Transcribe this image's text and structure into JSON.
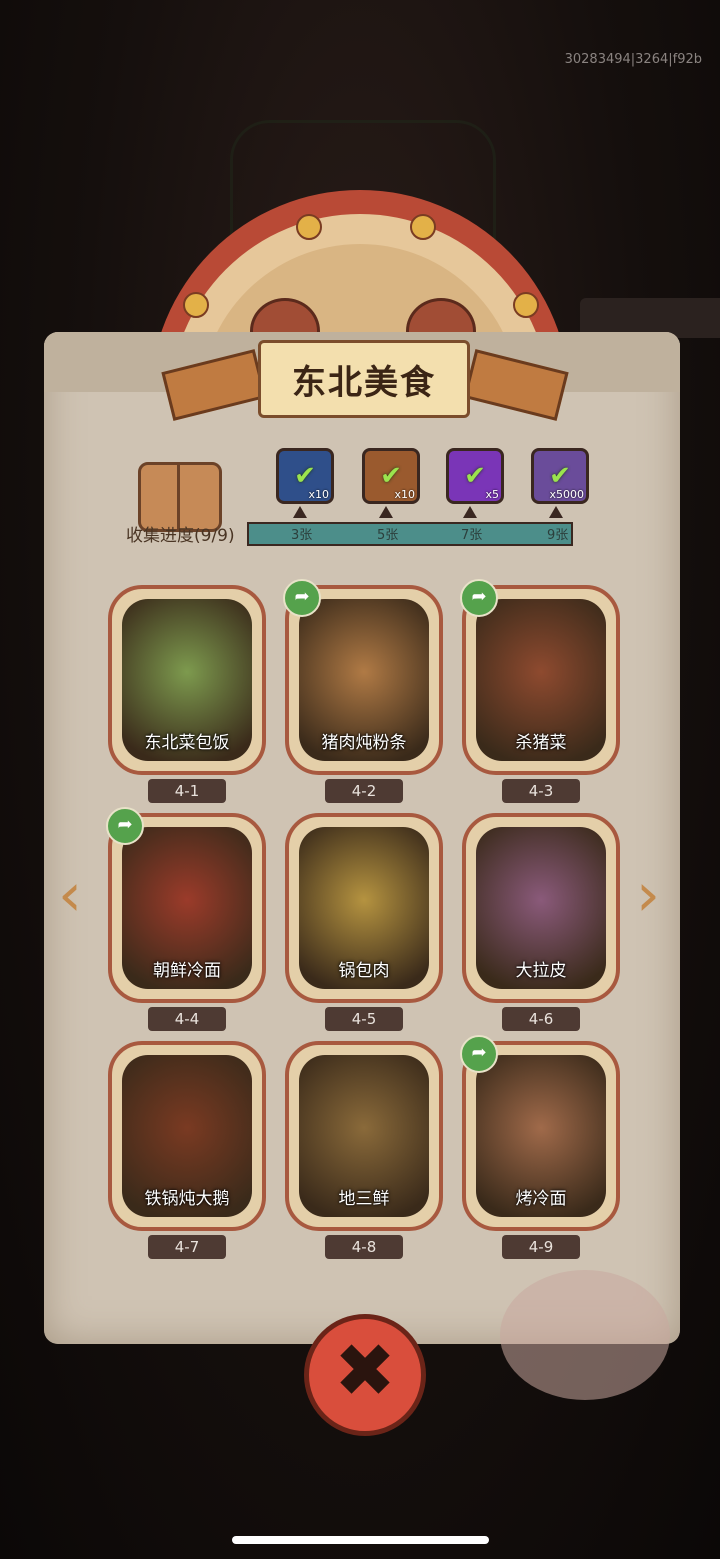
{
  "build_id": "30283494|3264|f92b",
  "title": "东北美食",
  "progress_label": "收集进度(9/9)",
  "rewards": [
    {
      "icon": "blue-gear-box-icon",
      "count": "x10",
      "color": "#2f4f8a"
    },
    {
      "icon": "brown-key-box-icon",
      "count": "x10",
      "color": "#9a5a2e"
    },
    {
      "icon": "purple-gem-icon",
      "count": "x5",
      "color": "#7a35b7"
    },
    {
      "icon": "purple-ticket-icon",
      "count": "x5000",
      "color": "#6a4c9a"
    }
  ],
  "milestones": [
    "3张",
    "5张",
    "7张",
    "9张"
  ],
  "dishes": [
    {
      "name": "东北菜包饭",
      "code": "4-1",
      "shared": false,
      "color": "#7d9a4e"
    },
    {
      "name": "猪肉炖粉条",
      "code": "4-2",
      "shared": true,
      "color": "#b07a45"
    },
    {
      "name": "杀猪菜",
      "code": "4-3",
      "shared": true,
      "color": "#8e4a2f"
    },
    {
      "name": "朝鲜冷面",
      "code": "4-4",
      "shared": true,
      "color": "#9b3b2a"
    },
    {
      "name": "锅包肉",
      "code": "4-5",
      "shared": false,
      "color": "#b59340"
    },
    {
      "name": "大拉皮",
      "code": "4-6",
      "shared": false,
      "color": "#8a5a7a"
    },
    {
      "name": "铁锅炖大鹅",
      "code": "4-7",
      "shared": false,
      "color": "#7a3a22"
    },
    {
      "name": "地三鲜",
      "code": "4-8",
      "shared": false,
      "color": "#8a6a3a"
    },
    {
      "name": "烤冷面",
      "code": "4-9",
      "shared": true,
      "color": "#a06a4a"
    }
  ],
  "close_symbol": "✖"
}
